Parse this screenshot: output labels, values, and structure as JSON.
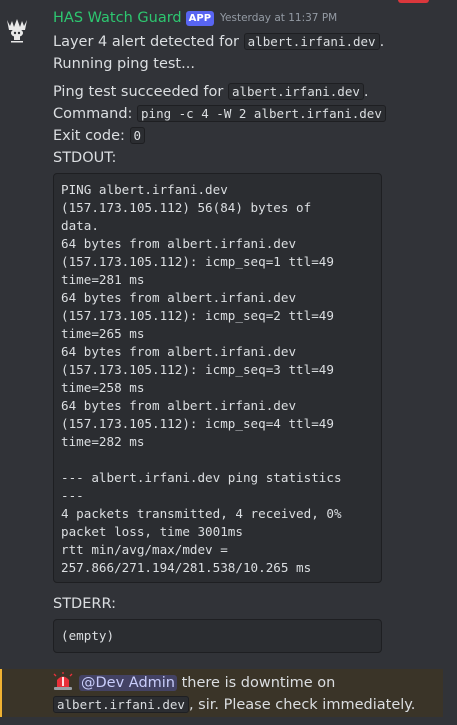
{
  "message": {
    "author": "HAS Watch Guard",
    "badge": "APP",
    "timestamp": "Yesterday at 11:37 PM",
    "alert_prefix": "Layer 4 alert detected for ",
    "alert_host": "albert.irfani.dev",
    "alert_suffix": ".",
    "running": "Running ping test...",
    "success_prefix": "Ping test succeeded for ",
    "success_host": "albert.irfani.dev",
    "success_suffix": ".",
    "command_label": "Command: ",
    "command": "ping -c 4 -W 2 albert.irfani.dev",
    "exit_label": "Exit code: ",
    "exit_code": "0",
    "stdout_label": "STDOUT:",
    "stdout": "PING albert.irfani.dev\n(157.173.105.112) 56(84) bytes of\ndata.\n64 bytes from albert.irfani.dev\n(157.173.105.112): icmp_seq=1 ttl=49\ntime=281 ms\n64 bytes from albert.irfani.dev\n(157.173.105.112): icmp_seq=2 ttl=49\ntime=265 ms\n64 bytes from albert.irfani.dev\n(157.173.105.112): icmp_seq=3 ttl=49\ntime=258 ms\n64 bytes from albert.irfani.dev\n(157.173.105.112): icmp_seq=4 ttl=49\ntime=282 ms\n\n--- albert.irfani.dev ping statistics\n---\n4 packets transmitted, 4 received, 0%\npacket loss, time 3001ms\nrtt min/avg/max/mdev =\n257.866/271.194/281.538/10.265 ms",
    "stderr_label": "STDERR:",
    "stderr": "(empty)"
  },
  "alert": {
    "icon": "siren-icon",
    "mention": "@Dev Admin",
    "text_a": " there is downtime on",
    "host": "albert.irfani.dev",
    "text_b": ", sir. Please check immediately."
  },
  "colors": {
    "background": "#313338",
    "author": "#2dc770",
    "badge": "#5865f2",
    "alert_bg": "#3a3428",
    "alert_border": "#f0b232",
    "mention": "#c9cdfb"
  }
}
